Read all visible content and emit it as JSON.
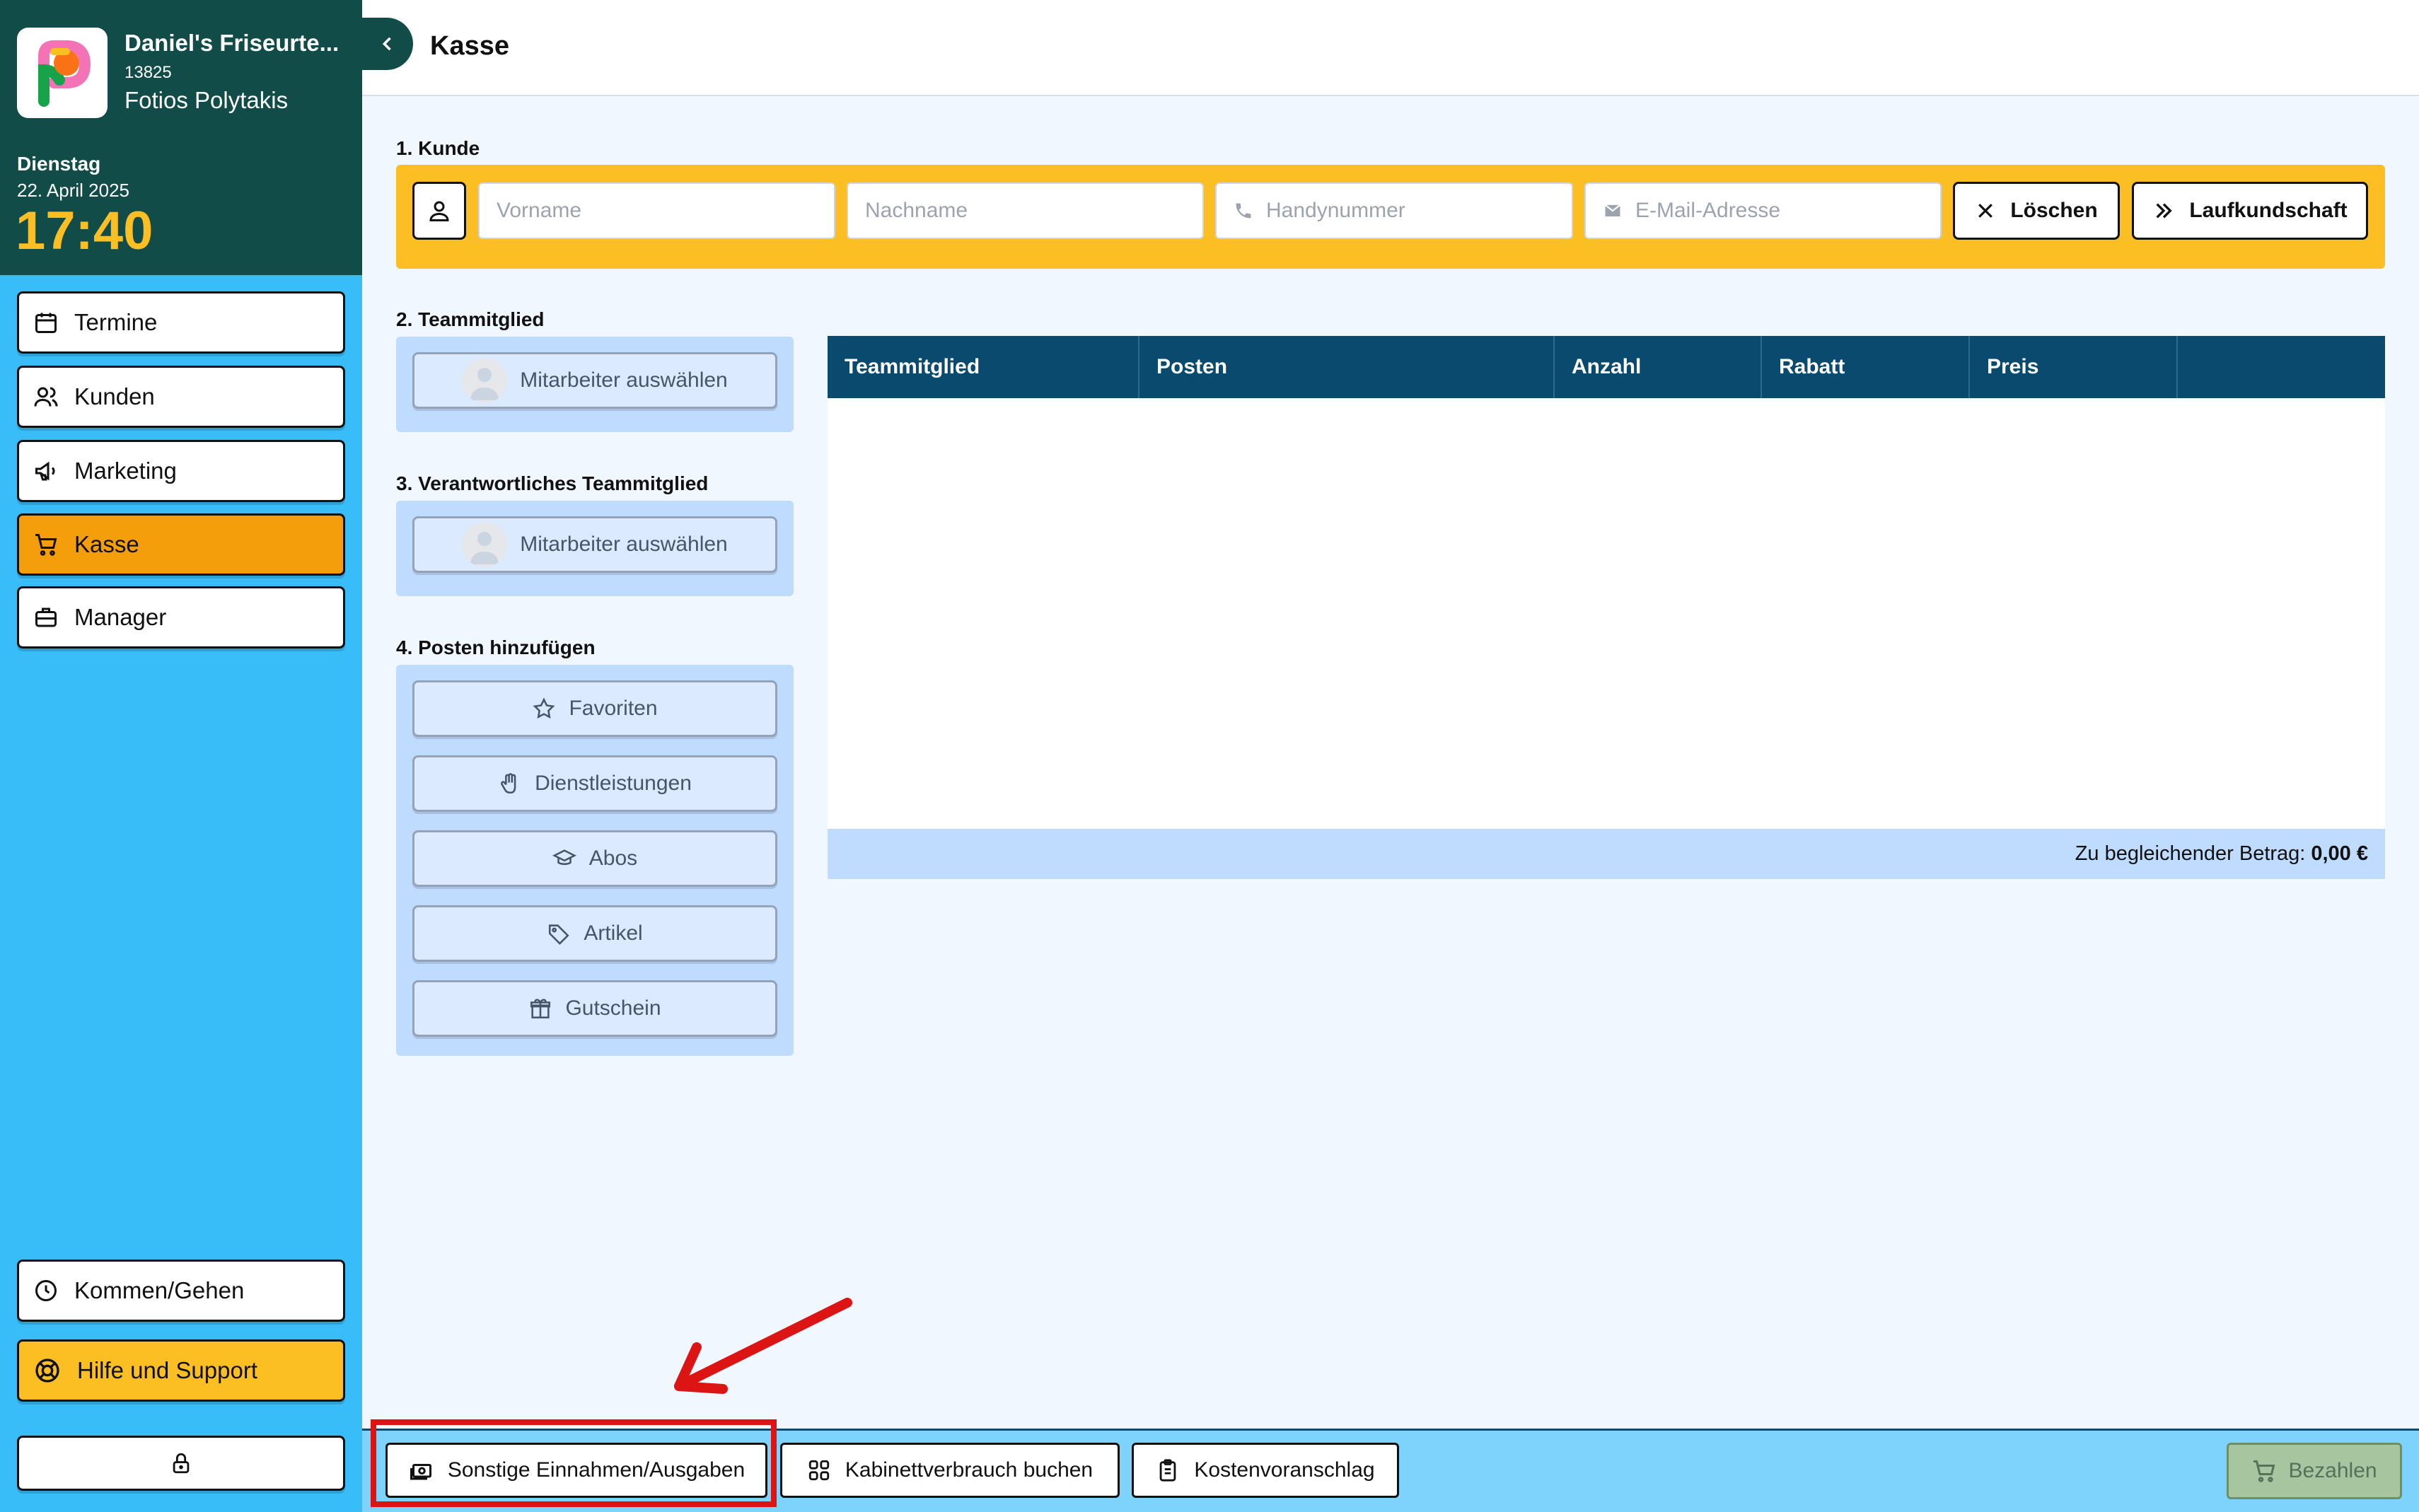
{
  "sidebar": {
    "salon_name": "Daniel's Friseurte...",
    "salon_id": "13825",
    "user_name": "Fotios Polytakis",
    "weekday": "Dienstag",
    "date": "22. April 2025",
    "time": "17:40",
    "nav": [
      {
        "label": "Termine",
        "icon": "calendar-icon"
      },
      {
        "label": "Kunden",
        "icon": "users-icon"
      },
      {
        "label": "Marketing",
        "icon": "megaphone-icon"
      },
      {
        "label": "Kasse",
        "icon": "cart-icon",
        "active": true
      },
      {
        "label": "Manager",
        "icon": "briefcase-icon"
      }
    ],
    "checkin_label": "Kommen/Gehen",
    "support_label": "Hilfe und Support",
    "lock_icon": "lock-icon"
  },
  "header": {
    "title": "Kasse"
  },
  "kunde": {
    "title": "1. Kunde",
    "vorname_placeholder": "Vorname",
    "nachname_placeholder": "Nachname",
    "phone_placeholder": "Handynummer",
    "email_placeholder": "E-Mail-Adresse",
    "clear_label": "Löschen",
    "walkin_label": "Laufkundschaft"
  },
  "team": {
    "title": "2. Teammitglied",
    "select_label": "Mitarbeiter auswählen"
  },
  "responsible": {
    "title": "3. Verantwortliches Teammitglied",
    "select_label": "Mitarbeiter auswählen"
  },
  "posten": {
    "title": "4. Posten hinzufügen",
    "buttons": [
      {
        "label": "Favoriten",
        "icon": "star-icon"
      },
      {
        "label": "Dienstleistungen",
        "icon": "hand-icon"
      },
      {
        "label": "Abos",
        "icon": "graduation-cap-icon"
      },
      {
        "label": "Artikel",
        "icon": "tag-icon"
      },
      {
        "label": "Gutschein",
        "icon": "gift-icon"
      }
    ]
  },
  "table": {
    "columns": [
      "Teammitglied",
      "Posten",
      "Anzahl",
      "Rabatt",
      "Preis",
      ""
    ],
    "rows": [],
    "total_label": "Zu begleichender Betrag:",
    "total_value": "0,00 €"
  },
  "bottom": {
    "other_label": "Sonstige Einnahmen/Ausgaben",
    "cabinet_label": "Kabinettverbrauch buchen",
    "estimate_label": "Kostenvoranschlag",
    "pay_label": "Bezahlen"
  },
  "colors": {
    "sidebar_bg": "#38bdf8",
    "sidebar_header": "#124c49",
    "accent_yellow": "#fbbf24",
    "active_orange": "#f59e0b",
    "table_header": "#0b4a6f",
    "annotation_red": "#dc1414"
  }
}
